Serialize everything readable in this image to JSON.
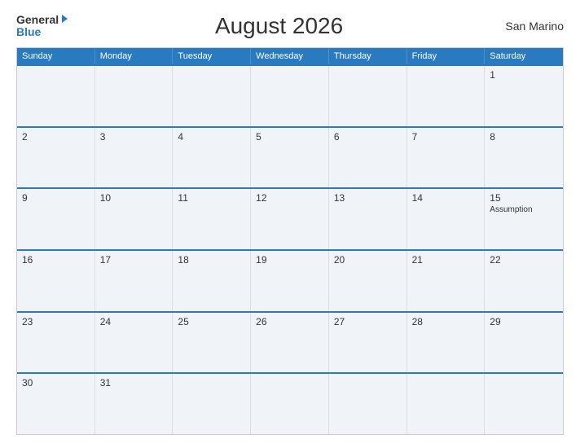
{
  "header": {
    "logo_general": "General",
    "logo_blue": "Blue",
    "title": "August 2026",
    "country": "San Marino"
  },
  "days_of_week": [
    "Sunday",
    "Monday",
    "Tuesday",
    "Wednesday",
    "Thursday",
    "Friday",
    "Saturday"
  ],
  "weeks": [
    [
      {
        "day": "",
        "empty": true
      },
      {
        "day": "",
        "empty": true
      },
      {
        "day": "",
        "empty": true
      },
      {
        "day": "",
        "empty": true
      },
      {
        "day": "",
        "empty": true
      },
      {
        "day": "",
        "empty": true
      },
      {
        "day": "1",
        "holiday": ""
      }
    ],
    [
      {
        "day": "2",
        "holiday": ""
      },
      {
        "day": "3",
        "holiday": ""
      },
      {
        "day": "4",
        "holiday": ""
      },
      {
        "day": "5",
        "holiday": ""
      },
      {
        "day": "6",
        "holiday": ""
      },
      {
        "day": "7",
        "holiday": ""
      },
      {
        "day": "8",
        "holiday": ""
      }
    ],
    [
      {
        "day": "9",
        "holiday": ""
      },
      {
        "day": "10",
        "holiday": ""
      },
      {
        "day": "11",
        "holiday": ""
      },
      {
        "day": "12",
        "holiday": ""
      },
      {
        "day": "13",
        "holiday": ""
      },
      {
        "day": "14",
        "holiday": ""
      },
      {
        "day": "15",
        "holiday": "Assumption"
      }
    ],
    [
      {
        "day": "16",
        "holiday": ""
      },
      {
        "day": "17",
        "holiday": ""
      },
      {
        "day": "18",
        "holiday": ""
      },
      {
        "day": "19",
        "holiday": ""
      },
      {
        "day": "20",
        "holiday": ""
      },
      {
        "day": "21",
        "holiday": ""
      },
      {
        "day": "22",
        "holiday": ""
      }
    ],
    [
      {
        "day": "23",
        "holiday": ""
      },
      {
        "day": "24",
        "holiday": ""
      },
      {
        "day": "25",
        "holiday": ""
      },
      {
        "day": "26",
        "holiday": ""
      },
      {
        "day": "27",
        "holiday": ""
      },
      {
        "day": "28",
        "holiday": ""
      },
      {
        "day": "29",
        "holiday": ""
      }
    ],
    [
      {
        "day": "30",
        "holiday": ""
      },
      {
        "day": "31",
        "holiday": ""
      },
      {
        "day": "",
        "empty": true
      },
      {
        "day": "",
        "empty": true
      },
      {
        "day": "",
        "empty": true
      },
      {
        "day": "",
        "empty": true
      },
      {
        "day": "",
        "empty": true
      }
    ]
  ]
}
